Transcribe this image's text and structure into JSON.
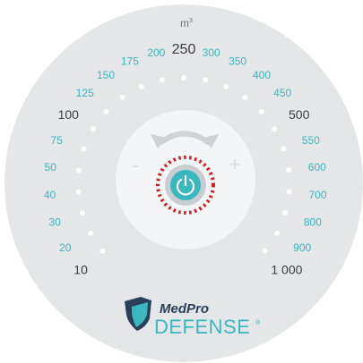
{
  "unit_label": "m",
  "unit_superscript": "3",
  "scale": [
    {
      "label": "10",
      "style": "dark"
    },
    {
      "label": "20",
      "style": "teal"
    },
    {
      "label": "30",
      "style": "teal"
    },
    {
      "label": "40",
      "style": "teal"
    },
    {
      "label": "50",
      "style": "teal"
    },
    {
      "label": "75",
      "style": "teal"
    },
    {
      "label": "100",
      "style": "dark"
    },
    {
      "label": "125",
      "style": "teal"
    },
    {
      "label": "150",
      "style": "teal"
    },
    {
      "label": "175",
      "style": "teal"
    },
    {
      "label": "200",
      "style": "teal"
    },
    {
      "label": "250",
      "style": "big"
    },
    {
      "label": "300",
      "style": "teal"
    },
    {
      "label": "350",
      "style": "teal"
    },
    {
      "label": "400",
      "style": "teal"
    },
    {
      "label": "450",
      "style": "teal"
    },
    {
      "label": "500",
      "style": "dark"
    },
    {
      "label": "550",
      "style": "teal"
    },
    {
      "label": "600",
      "style": "teal"
    },
    {
      "label": "700",
      "style": "teal"
    },
    {
      "label": "800",
      "style": "teal"
    },
    {
      "label": "900",
      "style": "teal"
    },
    {
      "label": "1 000",
      "style": "dark"
    }
  ],
  "controls": {
    "minus_label": "-",
    "plus_label": "+"
  },
  "icons": {
    "rotate": "rotate-arrows-icon",
    "power": "power-icon"
  },
  "brand": {
    "name_top": "MedPro",
    "name_main": "DEFENSE",
    "registered": "®"
  },
  "colors": {
    "bezel": "#e4e6e8",
    "center": "#f4f5f6",
    "accent": "#3ab7bf",
    "dark_text": "#3b3f44",
    "brand_navy": "#2a3f59",
    "highlight_ring": "#d7191c"
  }
}
